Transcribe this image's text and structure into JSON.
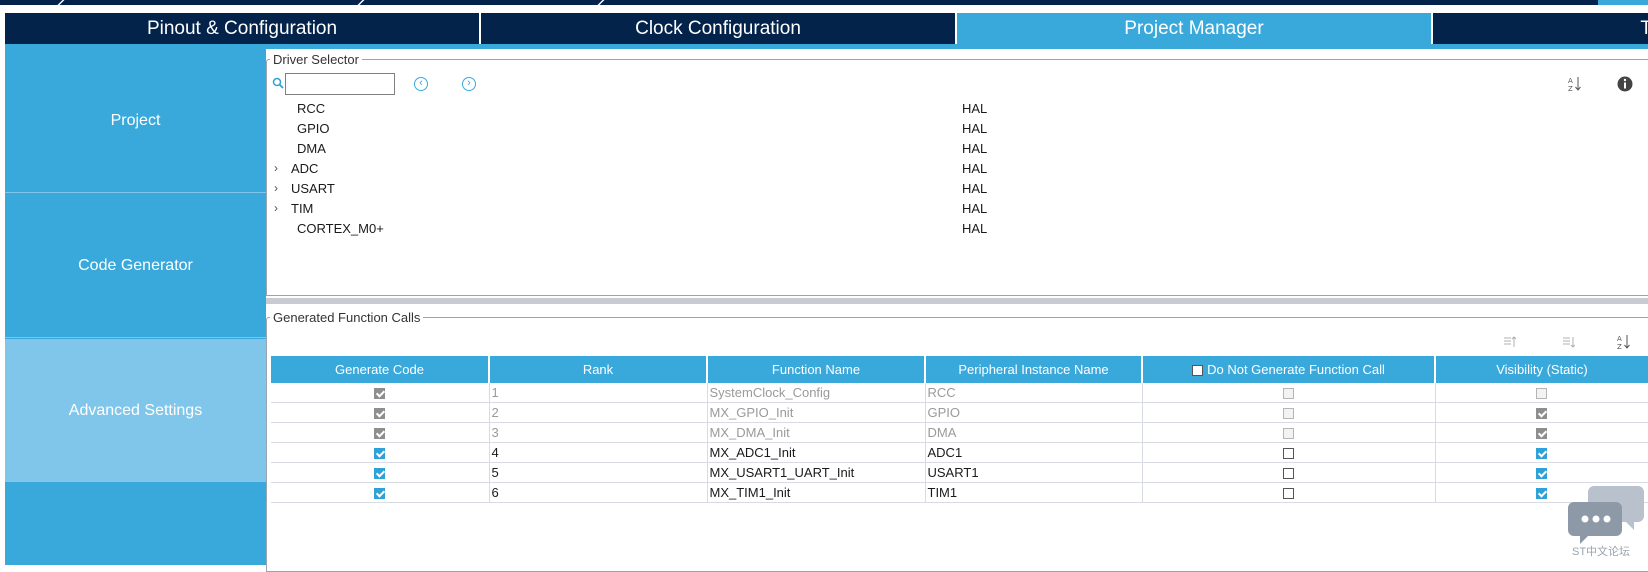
{
  "tabs": [
    {
      "label": "Pinout & Configuration",
      "active": false
    },
    {
      "label": "Clock Configuration",
      "active": false
    },
    {
      "label": "Project Manager",
      "active": true
    },
    {
      "label": "T",
      "active": false
    }
  ],
  "sidebar": {
    "items": [
      {
        "label": "Project",
        "selected": false
      },
      {
        "label": "Code Generator",
        "selected": false
      },
      {
        "label": "Advanced Settings",
        "selected": true
      }
    ]
  },
  "driver_selector": {
    "legend": "Driver Selector",
    "search": {
      "value": "",
      "placeholder": ""
    },
    "rows": [
      {
        "name": "RCC",
        "driver": "HAL",
        "expandable": false
      },
      {
        "name": "GPIO",
        "driver": "HAL",
        "expandable": false
      },
      {
        "name": "DMA",
        "driver": "HAL",
        "expandable": false
      },
      {
        "name": "ADC",
        "driver": "HAL",
        "expandable": true
      },
      {
        "name": "USART",
        "driver": "HAL",
        "expandable": true
      },
      {
        "name": "TIM",
        "driver": "HAL",
        "expandable": true
      },
      {
        "name": "CORTEX_M0+",
        "driver": "HAL",
        "expandable": false
      }
    ]
  },
  "function_calls": {
    "legend": "Generated Function Calls",
    "columns": [
      "Generate Code",
      "Rank",
      "Function Name",
      "Peripheral Instance Name",
      "Do Not Generate Function Call",
      "Visibility (Static)"
    ],
    "rows": [
      {
        "generate": true,
        "rank": "1",
        "function": "SystemClock_Config",
        "instance": "RCC",
        "do_not_generate": false,
        "visibility": false,
        "disabled": true
      },
      {
        "generate": true,
        "rank": "2",
        "function": "MX_GPIO_Init",
        "instance": "GPIO",
        "do_not_generate": false,
        "visibility": true,
        "disabled": true
      },
      {
        "generate": true,
        "rank": "3",
        "function": "MX_DMA_Init",
        "instance": "DMA",
        "do_not_generate": false,
        "visibility": true,
        "disabled": true
      },
      {
        "generate": true,
        "rank": "4",
        "function": "MX_ADC1_Init",
        "instance": "ADC1",
        "do_not_generate": false,
        "visibility": true,
        "disabled": false
      },
      {
        "generate": true,
        "rank": "5",
        "function": "MX_USART1_UART_Init",
        "instance": "USART1",
        "do_not_generate": false,
        "visibility": true,
        "disabled": false
      },
      {
        "generate": true,
        "rank": "6",
        "function": "MX_TIM1_Init",
        "instance": "TIM1",
        "do_not_generate": false,
        "visibility": true,
        "disabled": false
      }
    ]
  },
  "watermark": {
    "text": "ST中文论坛"
  },
  "colors": {
    "navy": "#03234b",
    "accent": "#39a9dc",
    "sidebar_selected": "#7fc6ea"
  }
}
